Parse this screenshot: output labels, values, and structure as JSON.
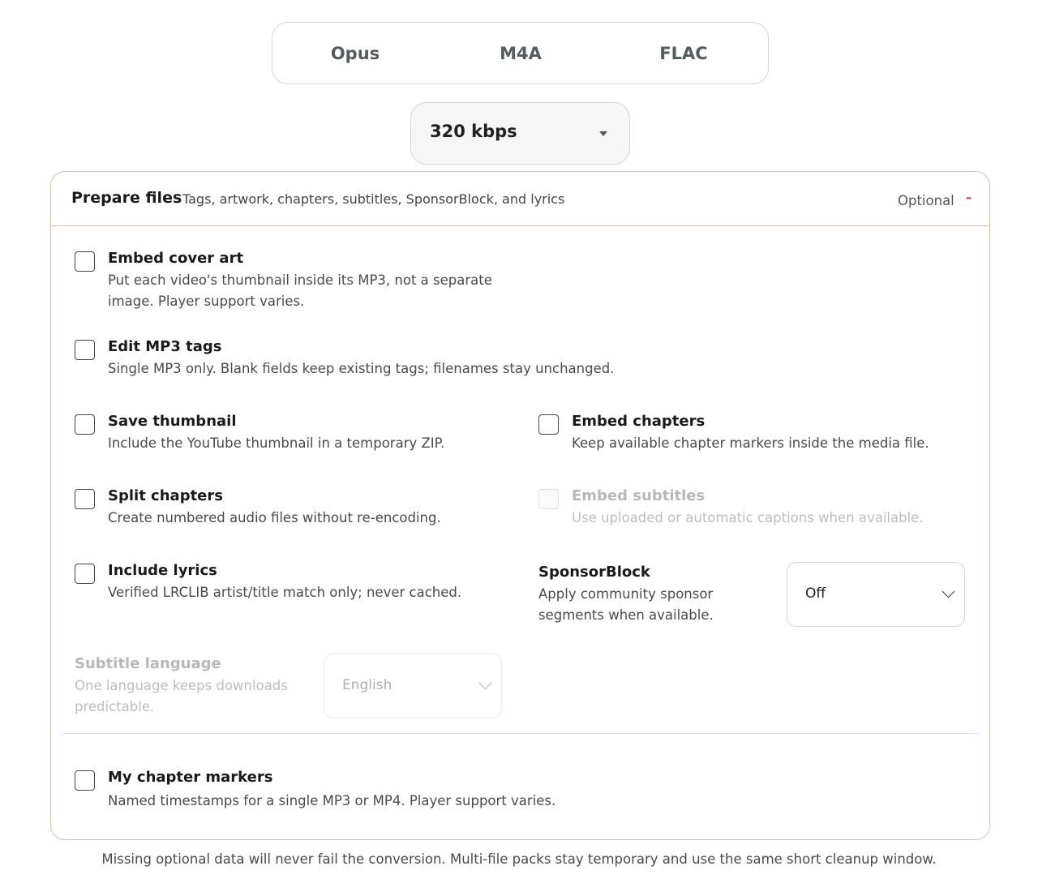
{
  "formats": [
    "Opus",
    "M4A",
    "FLAC"
  ],
  "bitrate": {
    "value": "320 kbps"
  },
  "panel": {
    "title": "Prepare files",
    "subtitle": "Tags, artwork, chapters, subtitles, SponsorBlock, and lyrics",
    "optional_label": "Optional",
    "collapse_symbol": "-"
  },
  "options": {
    "embed_cover_art": {
      "title": "Embed cover art",
      "desc": "Put each video's thumbnail inside its MP3, not a separate image. Player support varies.",
      "checked": false
    },
    "edit_mp3_tags": {
      "title": "Edit MP3 tags",
      "desc": "Single MP3 only. Blank fields keep existing tags; filenames stay unchanged.",
      "checked": false
    },
    "save_thumbnail": {
      "title": "Save thumbnail",
      "desc": "Include the YouTube thumbnail in a temporary ZIP.",
      "checked": false
    },
    "embed_chapters": {
      "title": "Embed chapters",
      "desc": "Keep available chapter markers inside the media file.",
      "checked": false
    },
    "split_chapters": {
      "title": "Split chapters",
      "desc": "Create numbered audio files without re-encoding.",
      "checked": false
    },
    "embed_subtitles": {
      "title": "Embed subtitles",
      "desc": "Use uploaded or automatic captions when available.",
      "checked": false,
      "disabled": true
    },
    "include_lyrics": {
      "title": "Include lyrics",
      "desc": "Verified LRCLIB artist/title match only; never cached.",
      "checked": false
    },
    "my_chapter_markers": {
      "title": "My chapter markers",
      "desc": "Named timestamps for a single MP3 or MP4. Player support varies.",
      "checked": false
    }
  },
  "sponsorblock": {
    "title": "SponsorBlock",
    "desc": "Apply community sponsor segments when available.",
    "value": "Off"
  },
  "subtitle_language": {
    "title": "Subtitle language",
    "desc": "One language keeps downloads predictable.",
    "value": "English",
    "disabled": true
  },
  "footer_note": "Missing optional data will never fail the conversion. Multi-file packs stay temporary and use the same short cleanup window.",
  "colors": {
    "panel_border": "#d9c3b4",
    "accent": "#d9533b"
  },
  "icons": {
    "bitrate_caret": "caret-down-icon",
    "select_chevron": "chevron-down-icon"
  }
}
